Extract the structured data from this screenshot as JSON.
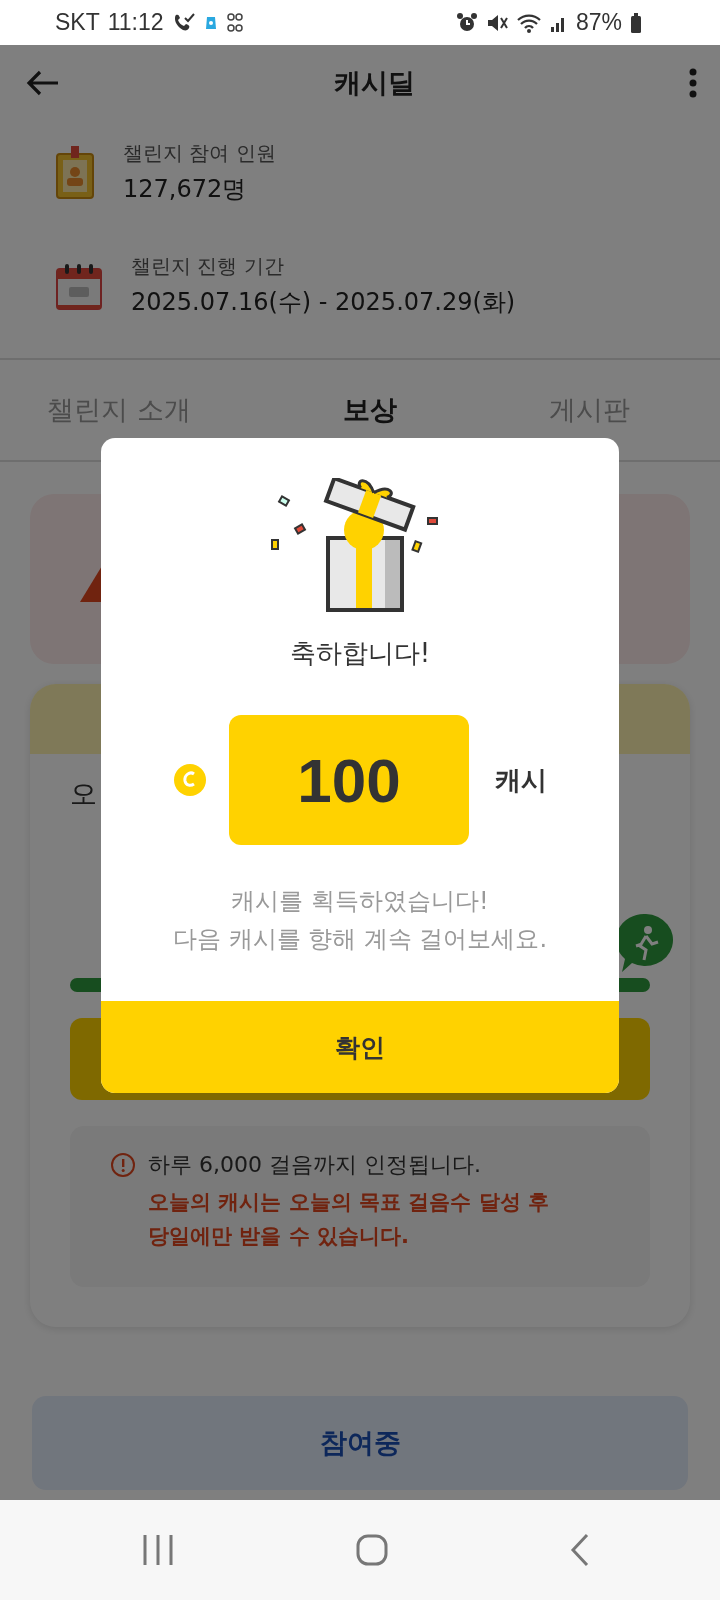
{
  "status_bar": {
    "carrier": "SKT",
    "time": "11:12",
    "battery": "87%"
  },
  "header": {
    "title": "캐시딜"
  },
  "info": [
    {
      "kind": "badge",
      "label": "챌린지 참여 인원",
      "value": "127,672명"
    },
    {
      "kind": "calendar",
      "label": "챌린지 진행 기간",
      "value": "2025.07.16(수) - 2025.07.29(화)"
    }
  ],
  "tabs": [
    {
      "label": "챌린지 소개",
      "selected": false
    },
    {
      "label": "보상",
      "selected": true
    },
    {
      "label": "게시판",
      "selected": false
    }
  ],
  "step_card": {
    "heading": "오"
  },
  "notice": {
    "info": "하루 6,000 걸음까지 인정됩니다.",
    "warning": "오늘의 캐시는 오늘의 목표 걸음수 달성 후 당일에만 받을 수 있습니다."
  },
  "join_button": {
    "label": "참여중"
  },
  "dialog": {
    "open": true,
    "title": "축하합니다!",
    "amount": "100",
    "unit": "캐시",
    "message": [
      "캐시를 획득하였습니다!",
      "다음 캐시를 향해 계속 걸어보세요."
    ],
    "confirm": "확인"
  }
}
